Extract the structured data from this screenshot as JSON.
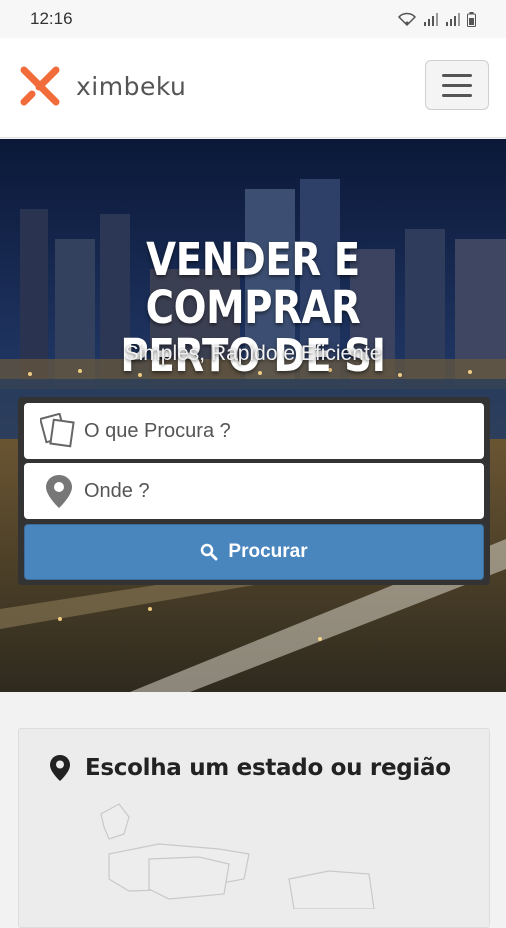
{
  "status_bar": {
    "time": "12:16"
  },
  "navbar": {
    "logo_text": "ximbeku",
    "brand_color": "#f26b3a",
    "menu_icon": "hamburger-icon"
  },
  "hero": {
    "title_line1": "VENDER E COMPRAR",
    "title_line2": "PERTO DE SI",
    "subtitle": "Simples, Rapido e Eficiente"
  },
  "search": {
    "what_placeholder": "O que Procura ?",
    "where_placeholder": "Onde ?",
    "button_label": "Procurar",
    "button_color": "#4a86be"
  },
  "region": {
    "title": "Escolha um estado ou região"
  }
}
